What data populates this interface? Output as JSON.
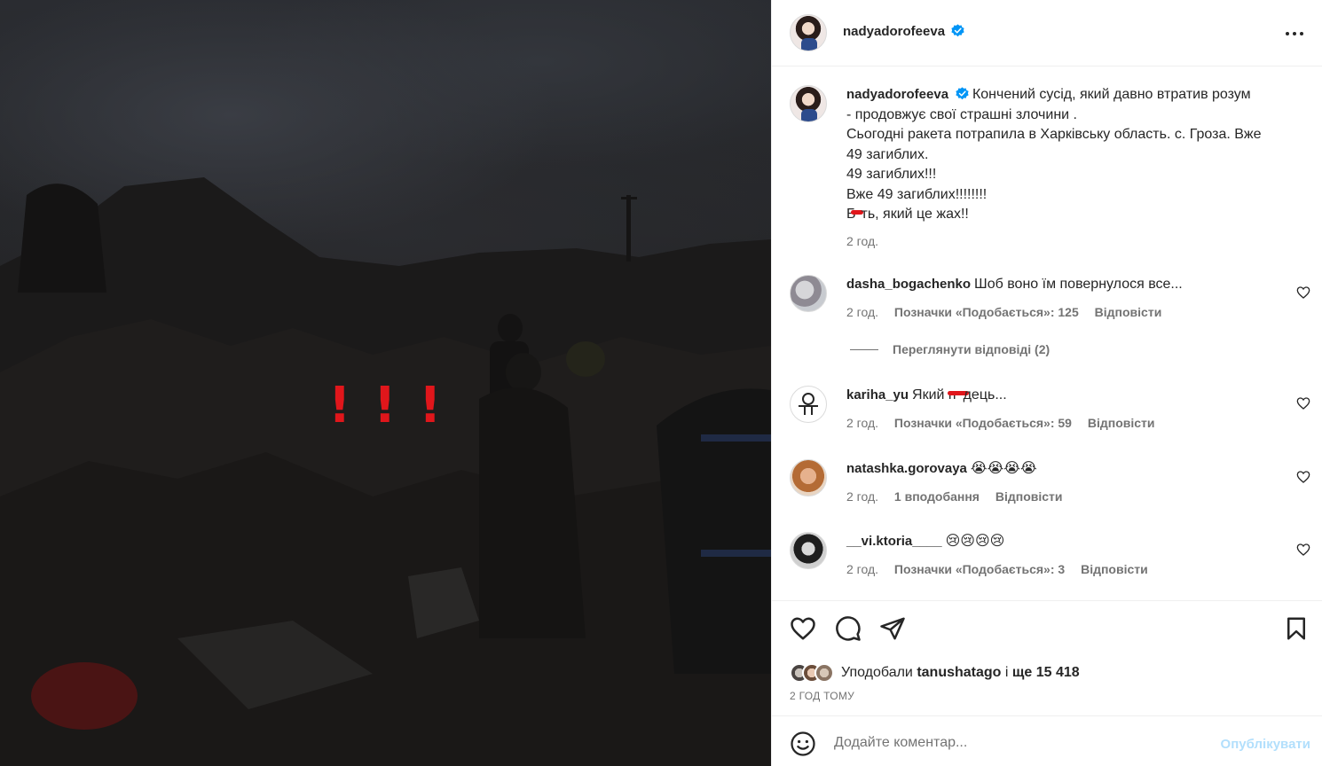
{
  "author": {
    "username": "nadyadorofeeva",
    "verified": true
  },
  "caption": {
    "lines": [
      "Кончений сусід, який давно втратив розум",
      "- продовжує свої страшні злочини .",
      "Сьогодні ракета потрапила в Харківську область. с. Гроза. Вже",
      "49 загиблих.",
      "49 загиблих!!!",
      "Вже 49 загиблих!!!!!!!!",
      "Б",
      "ть, який це жах!!"
    ],
    "time": "2 год."
  },
  "comments": [
    {
      "username": "dasha_bogachenko",
      "text": "Шоб воно їм повернулося все...",
      "time": "2 год.",
      "likes": "Позначки «Подобається»: 125",
      "reply": "Відповісти"
    },
    {
      "username": "kariha_yu",
      "text_before": "Який п",
      "text_after": "дець...",
      "time": "2 год.",
      "likes": "Позначки «Подобається»: 59",
      "reply": "Відповісти"
    },
    {
      "username": "natashka.gorovaya",
      "text": "😭😭😭😭",
      "time": "2 год.",
      "likes": "1 вподобання",
      "reply": "Відповісти"
    },
    {
      "username": "__vi.ktoria____",
      "text": "😢😢😢😢",
      "time": "2 год.",
      "likes": "Позначки «Подобається»: 3",
      "reply": "Відповісти"
    }
  ],
  "view_replies": "Переглянути відповіді (2)",
  "likes_summary": {
    "prefix": "Уподобали",
    "user": "tanushatago",
    "middle": "і",
    "count": "ще 15 418"
  },
  "post_time": "2 ГОД ТОМУ",
  "comment_input": {
    "placeholder": "Додайте коментар..."
  },
  "publish_label": "Опублікувати",
  "photo_overlay": [
    "!",
    "!",
    "!"
  ],
  "icons": [
    "verified-badge-icon",
    "more-options-icon",
    "heart-icon",
    "comment-icon",
    "share-icon",
    "bookmark-icon",
    "emoji-icon"
  ],
  "colors": {
    "verified_blue": "#0095f6",
    "publish_disabled": "#b2dffc",
    "secondary_text": "#737373",
    "exclamation_red": "#e0161b"
  }
}
